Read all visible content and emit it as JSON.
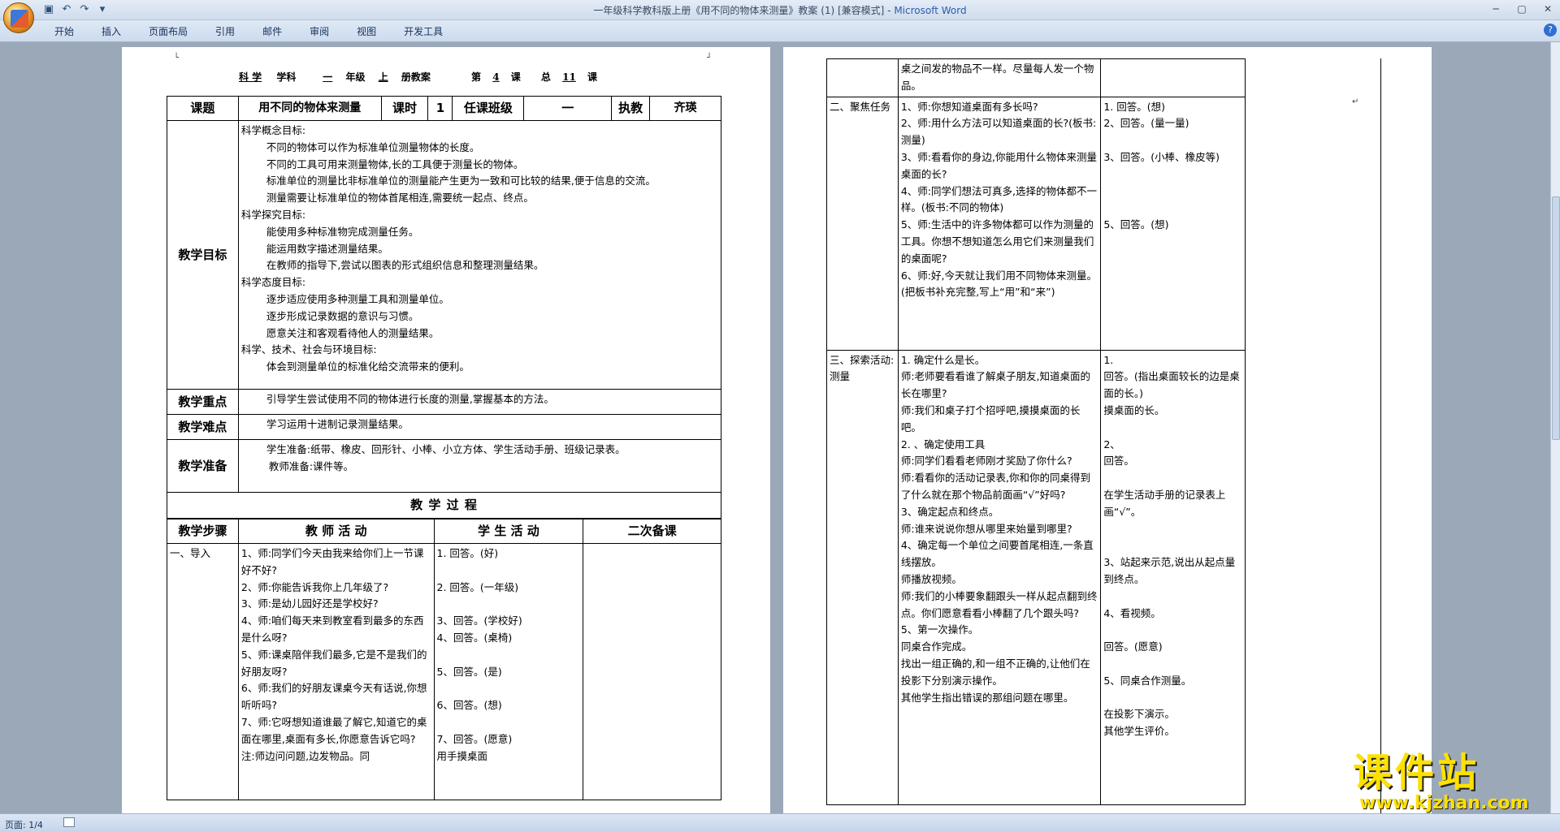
{
  "window": {
    "title": "一年级科学教科版上册《用不同的物体来测量》教案 (1) [兼容模式] - ",
    "app": "Microsoft Word"
  },
  "ribbon": {
    "tabs": [
      "开始",
      "插入",
      "页面布局",
      "引用",
      "邮件",
      "审阅",
      "视图",
      "开发工具"
    ]
  },
  "status": {
    "page": "页面: 1/4"
  },
  "header": {
    "subject": "科 学",
    "subject_suffix": "学科",
    "grade": "一",
    "grade_suffix": "年级",
    "term": "上",
    "term_suffix": "册教案",
    "lesson_prefix": "第",
    "lesson": "4",
    "lesson_suffix": "课",
    "total_prefix": "总",
    "total": "11",
    "total_suffix": "课"
  },
  "info": {
    "topic_label": "课题",
    "topic": "用不同的物体来测量",
    "hours_label": "课时",
    "hours": "1",
    "class_label": "任课班级",
    "class": "一",
    "teacher_label": "执教",
    "teacher": "齐瑛"
  },
  "goals": {
    "label": "教学目标",
    "lines": [
      {
        "t": "科学概念目标:",
        "i": false
      },
      {
        "t": "不同的物体可以作为标准单位测量物体的长度。",
        "i": true
      },
      {
        "t": "不同的工具可用来测量物体,长的工具便于测量长的物体。",
        "i": true
      },
      {
        "t": "标准单位的测量比非标准单位的测量能产生更为一致和可比较的结果,便于信息的交流。",
        "i": true
      },
      {
        "t": "测量需要让标准单位的物体首尾相连,需要统一起点、终点。",
        "i": true
      },
      {
        "t": "科学探究目标:",
        "i": false
      },
      {
        "t": "能使用多种标准物完成测量任务。",
        "i": true
      },
      {
        "t": "能运用数字描述测量结果。",
        "i": true
      },
      {
        "t": "在教师的指导下,尝试以图表的形式组织信息和整理测量结果。",
        "i": true
      },
      {
        "t": "科学态度目标:",
        "i": false
      },
      {
        "t": "逐步适应使用多种测量工具和测量单位。",
        "i": true
      },
      {
        "t": "逐步形成记录数据的意识与习惯。",
        "i": true
      },
      {
        "t": "愿意关注和客观看待他人的测量结果。",
        "i": true
      },
      {
        "t": "科学、技术、社会与环境目标:",
        "i": false
      },
      {
        "t": "体会到测量单位的标准化给交流带来的便利。",
        "i": true
      }
    ]
  },
  "focus": {
    "label": "教学重点",
    "text": "引导学生尝试使用不同的物体进行长度的测量,掌握基本的方法。"
  },
  "difficulty": {
    "label": "教学难点",
    "text": "学习运用十进制记录测量结果。"
  },
  "prep": {
    "label": "教学准备",
    "student": "学生准备:纸带、橡皮、回形针、小棒、小立方体、学生活动手册、班级记录表。",
    "teacher": "教师准备:课件等。"
  },
  "process": {
    "title": "教 学 过 程",
    "headers": [
      "教学步骤",
      "教 师 活 动",
      "学 生 活 动",
      "二次备课"
    ]
  },
  "step1": {
    "name": "一、导入",
    "teacher": [
      "1、师:同学们今天由我来给你们上一节课好不好?",
      "2、师:你能告诉我你上几年级了?",
      "3、师:是幼儿园好还是学校好?",
      "4、师:咱们每天来到教室看到最多的东西是什么呀?",
      "5、师:课桌陪伴我们最多,它是不是我们的好朋友呀?",
      "6、师:我们的好朋友课桌今天有话说,你想听听吗?",
      "7、师:它呀想知道谁最了解它,知道它的桌面在哪里,桌面有多长,你愿意告诉它吗?",
      "注:师边问问题,边发物品。同"
    ],
    "student": [
      "1. 回答。(好)",
      "",
      "2. 回答。(一年级)",
      "",
      "3、回答。(学校好)",
      "4、回答。(桌椅)",
      "",
      "5、回答。(是)",
      "",
      "6、回答。(想)",
      "",
      "7、回答。(愿意)",
      "  用手摸桌面"
    ]
  },
  "p2": {
    "top_teacher": "桌之间发的物品不一样。尽量每人发一个物品。",
    "step2": {
      "name": "二、聚焦任务",
      "teacher": [
        "1、师:你想知道桌面有多长吗?",
        "2、师:用什么方法可以知道桌面的长?(板书:测量)",
        "3、师:看看你的身边,你能用什么物体来测量桌面的长?",
        "4、师:同学们想法可真多,选择的物体都不一样。(板书:不同的物体)",
        "5、师:生活中的许多物体都可以作为测量的工具。你想不想知道怎么用它们来测量我们的桌面呢?",
        "6、师:好,今天就让我们用不同物体来测量。(把板书补充完整,写上“用”和“来”)"
      ],
      "student": [
        "1. 回答。(想)",
        "2、回答。(量一量)",
        "",
        "3、回答。(小棒、橡皮等)",
        "",
        "",
        "",
        "5、回答。(想)"
      ]
    },
    "step3": {
      "name": "三、探索活动:测量",
      "teacher": [
        "1. 确定什么是长。",
        "   师:老师要看看谁了解桌子朋友,知道桌面的长在哪里?",
        "   师:我们和桌子打个招呼吧,摸摸桌面的长吧。",
        "2. 、确定使用工具",
        "师:同学们看看老师刚才奖励了你什么?",
        "师:看看你的活动记录表,你和你的同桌得到了什么就在那个物品前面画“√”好吗?",
        "3、确定起点和终点。",
        "师:谁来说说你想从哪里来始量到哪里?",
        "4、确定每一个单位之间要首尾相连,一条直线摆放。",
        "师播放视频。",
        "师:我们的小棒要象翻跟头一样从起点翻到终点。你们愿意看看小棒翻了几个跟头吗?",
        "5、第一次操作。",
        "同桌合作完成。",
        "找出一组正确的,和一组不正确的,让他们在投影下分别演示操作。",
        "其他学生指出错误的那组问题在哪里。"
      ],
      "student": [
        "1.",
        "  回答。(指出桌面较长的边是桌面的长。)",
        "  摸桌面的长。",
        "",
        "2、",
        "回答。",
        "",
        "在学生活动手册的记录表上画“√”。",
        "",
        "",
        "3、站起来示范,说出从起点量到终点。",
        "",
        "4、看视频。",
        "",
        "回答。(愿意)",
        "",
        "5、同桌合作测量。",
        "",
        "在投影下演示。",
        "其他学生评价。"
      ]
    }
  },
  "logo": {
    "text": "课件站",
    "url": "www.kjzhan.com"
  }
}
